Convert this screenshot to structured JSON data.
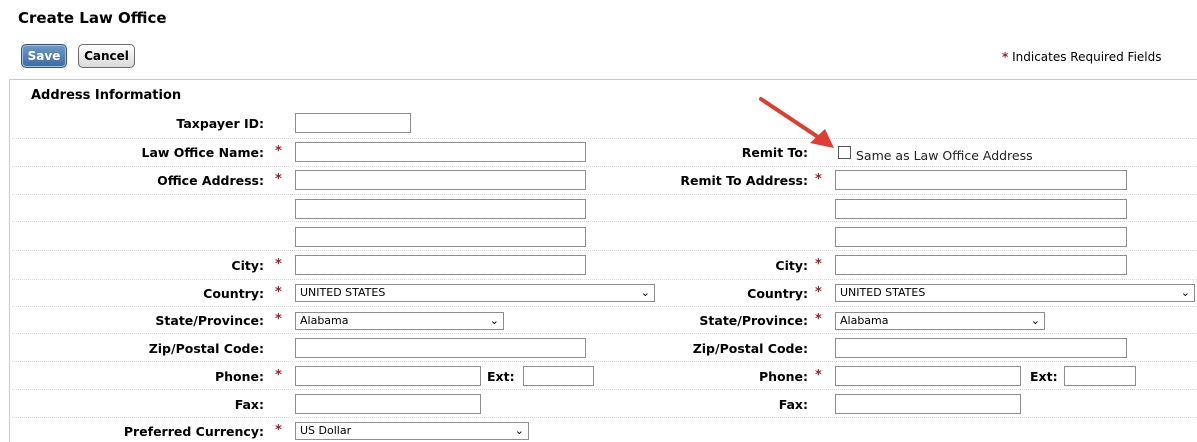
{
  "page": {
    "title": "Create Law Office"
  },
  "toolbar": {
    "save_label": "Save",
    "cancel_label": "Cancel",
    "required_star": "*",
    "required_note": "Indicates Required Fields"
  },
  "section": {
    "title": "Address Information"
  },
  "left": {
    "taxpayer_id": {
      "label": "Taxpayer ID:",
      "value": ""
    },
    "law_office_name": {
      "label": "Law Office Name:",
      "value": ""
    },
    "office_address": {
      "label": "Office Address:",
      "line1": "",
      "line2": "",
      "line3": ""
    },
    "city": {
      "label": "City:",
      "value": ""
    },
    "country": {
      "label": "Country:",
      "value": "UNITED STATES"
    },
    "state": {
      "label": "State/Province:",
      "value": "Alabama"
    },
    "zip": {
      "label": "Zip/Postal Code:",
      "value": ""
    },
    "phone": {
      "label": "Phone:",
      "value": "",
      "ext_label": "Ext:",
      "ext_value": ""
    },
    "fax": {
      "label": "Fax:",
      "value": ""
    },
    "currency": {
      "label": "Preferred Currency:",
      "value": "US Dollar"
    }
  },
  "right": {
    "remit_to": {
      "label": "Remit To:",
      "checkbox_label": "Same as Law Office Address",
      "checked": false
    },
    "remit_address": {
      "label": "Remit To Address:",
      "line1": "",
      "line2": "",
      "line3": ""
    },
    "city": {
      "label": "City:",
      "value": ""
    },
    "country": {
      "label": "Country:",
      "value": "UNITED STATES"
    },
    "state": {
      "label": "State/Province:",
      "value": "Alabama"
    },
    "zip": {
      "label": "Zip/Postal Code:",
      "value": ""
    },
    "phone": {
      "label": "Phone:",
      "value": "",
      "ext_label": "Ext:",
      "ext_value": ""
    },
    "fax": {
      "label": "Fax:",
      "value": ""
    }
  },
  "colors": {
    "accent": "#3c6aa3",
    "required": "#a32020",
    "annotation_arrow": "#e03c31"
  },
  "icons": {
    "dropdown": "chevron-down-icon",
    "annotation": "arrow-annotation-icon"
  }
}
